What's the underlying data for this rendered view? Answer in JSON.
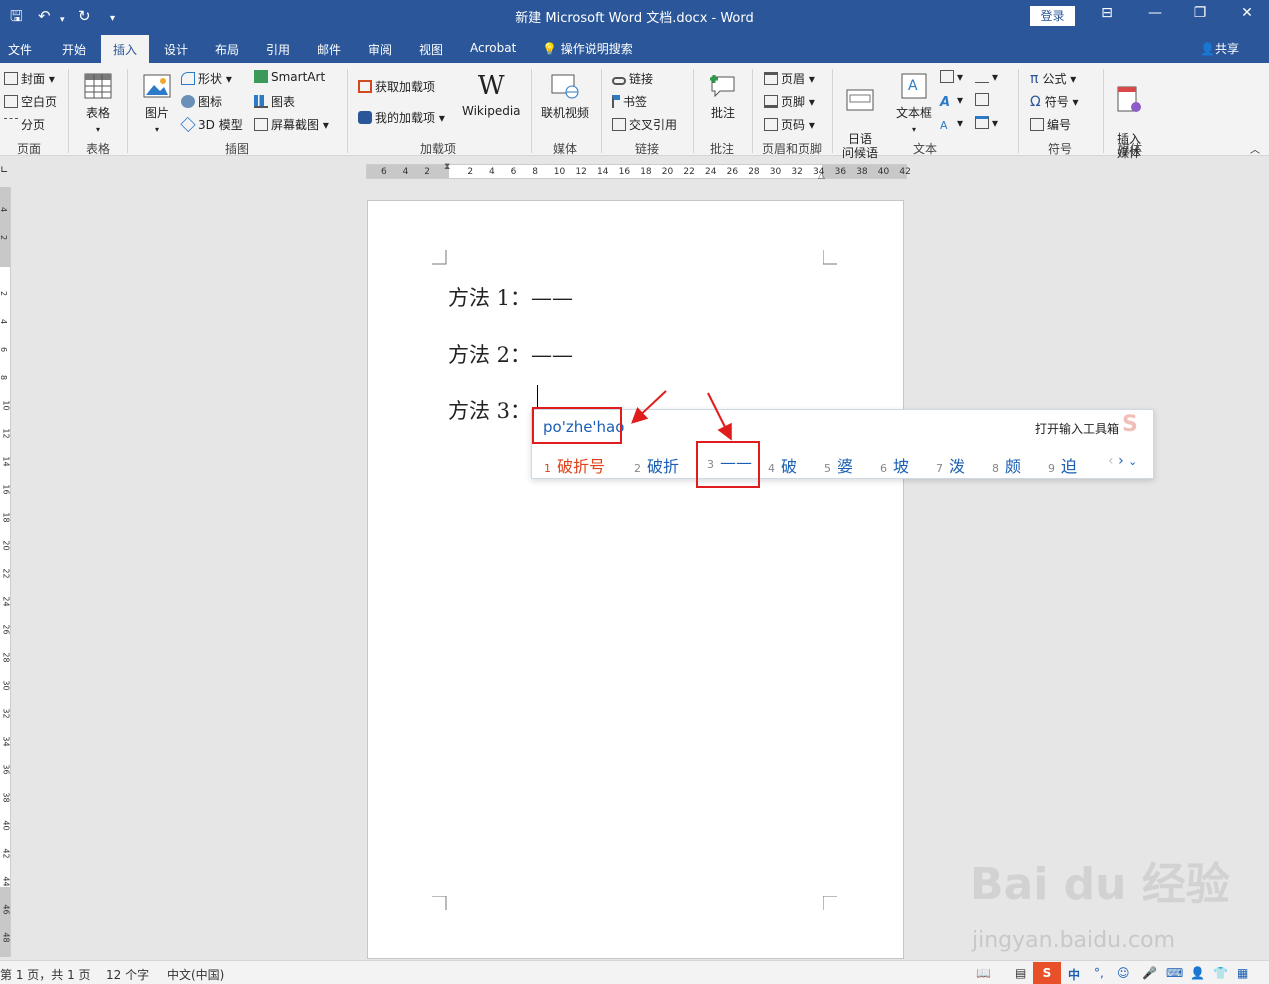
{
  "title_bar": {
    "title": "新建 Microsoft Word 文档.docx - Word",
    "login": "登录"
  },
  "tabs": [
    "文件",
    "开始",
    "插入",
    "设计",
    "布局",
    "引用",
    "邮件",
    "审阅",
    "视图",
    "Acrobat"
  ],
  "active_tab": "插入",
  "tell_me": "操作说明搜索",
  "share": "共享",
  "ribbon": {
    "pages": {
      "cover": "封面",
      "blank": "空白页",
      "break": "分页",
      "group": "页面"
    },
    "tables": {
      "table": "表格",
      "group": "表格"
    },
    "illustrations": {
      "pictures": "图片",
      "shapes": "形状",
      "icons": "图标",
      "model3d": "3D 模型",
      "smartart": "SmartArt",
      "chart": "图表",
      "screenshot": "屏幕截图",
      "group": "插图"
    },
    "addins": {
      "get": "获取加载项",
      "mine": "我的加载项",
      "wikipedia": "Wikipedia",
      "group": "加载项"
    },
    "media": {
      "video": "联机视频",
      "group": "媒体"
    },
    "links": {
      "link": "链接",
      "bookmark": "书签",
      "crossref": "交叉引用",
      "group": "链接"
    },
    "comments": {
      "comment": "批注",
      "group": "批注"
    },
    "header_footer": {
      "header": "页眉",
      "footer": "页脚",
      "pagenum": "页码",
      "group": "页眉和页脚"
    },
    "text": {
      "japanese": "日语\n问候语",
      "textbox": "文本框",
      "group": "文本"
    },
    "symbols": {
      "equation": "公式",
      "symbol": "符号",
      "number": "编号",
      "group": "符号"
    },
    "insert_media": {
      "label": "插入\n媒体",
      "group": "媒体"
    }
  },
  "ruler": {
    "h_ticks": [
      "6",
      "4",
      "2",
      "",
      "2",
      "4",
      "6",
      "8",
      "10",
      "12",
      "14",
      "16",
      "18",
      "20",
      "22",
      "24",
      "26",
      "28",
      "30",
      "32",
      "34",
      "36",
      "38",
      "40",
      "42"
    ],
    "v_ticks": [
      "4",
      "2",
      "",
      "2",
      "4",
      "6",
      "8",
      "10",
      "12",
      "14",
      "16",
      "18",
      "20",
      "22",
      "24",
      "26",
      "28",
      "30",
      "32",
      "34",
      "36",
      "38",
      "40",
      "42",
      "44",
      "46",
      "48"
    ]
  },
  "document": {
    "lines": [
      "方法 1：——",
      "方法 2：——",
      "方法 3："
    ]
  },
  "ime": {
    "pinyin": "po'zhe'hao",
    "toolbox": "打开输入工具箱",
    "candidates": [
      {
        "n": "1",
        "text": "破折号"
      },
      {
        "n": "2",
        "text": "破折"
      },
      {
        "n": "3",
        "text": "——"
      },
      {
        "n": "4",
        "text": "破"
      },
      {
        "n": "5",
        "text": "婆"
      },
      {
        "n": "6",
        "text": "坡"
      },
      {
        "n": "7",
        "text": "泼"
      },
      {
        "n": "8",
        "text": "颇"
      },
      {
        "n": "9",
        "text": "迫"
      }
    ]
  },
  "status": {
    "page": "第 1 页，共 1 页",
    "words": "12 个字",
    "lang": "中文(中国)"
  },
  "watermark": {
    "main": "Bai du 经验",
    "sub": "jingyan.baidu.com"
  },
  "colors": {
    "word_blue": "#2b579a",
    "annotation_red": "#e11c1c",
    "ime_blue": "#1a5fb4",
    "ime_red": "#e0421b"
  }
}
